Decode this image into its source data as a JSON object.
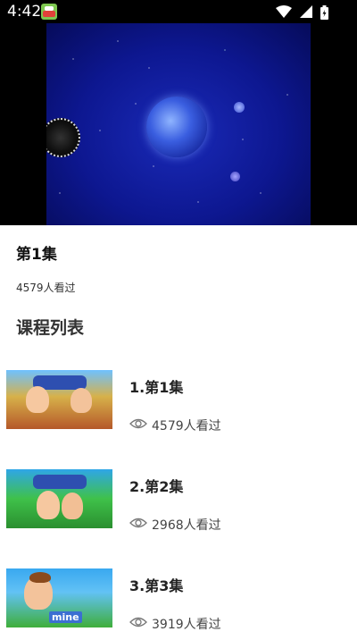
{
  "status_bar": {
    "time": "4:42",
    "app_icon": "app-notification-icon",
    "icons": [
      "wifi-icon",
      "signal-icon",
      "battery-icon"
    ]
  },
  "video": {
    "scene": "space-animation-frame"
  },
  "episode": {
    "title": "第1集",
    "views": "4579人看过"
  },
  "section": {
    "title": "课程列表"
  },
  "courses": [
    {
      "name": "1.第1集",
      "views": "4579人看过"
    },
    {
      "name": "2.第2集",
      "views": "2968人看过"
    },
    {
      "name": "3.第3集",
      "views": "3919人看过",
      "thumb_caption": "mine"
    }
  ],
  "colors": {
    "video_background": "#000000",
    "space_blue": "#0d1790",
    "text_primary": "#222222",
    "text_secondary": "#444444"
  }
}
